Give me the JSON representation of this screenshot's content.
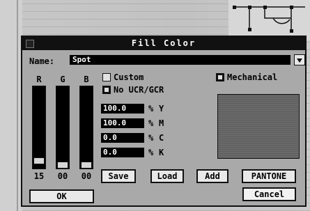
{
  "window": {
    "title": "Fill Color"
  },
  "name": {
    "label": "Name:",
    "value": "Spot"
  },
  "rgb": {
    "labels": [
      "R",
      "G",
      "B"
    ],
    "values": [
      "15",
      "00",
      "00"
    ],
    "levels": [
      0.06,
      0.0,
      0.0
    ]
  },
  "options": {
    "custom": {
      "label": "Custom",
      "checked": false
    },
    "no_ucr_gcr": {
      "label": "No UCR/GCR",
      "checked": true
    },
    "mechanical": {
      "label": "Mechanical",
      "checked": true
    }
  },
  "cmyk": {
    "percent_symbol": "%",
    "rows": [
      {
        "value": "100.0",
        "letter": "Y"
      },
      {
        "value": "100.0",
        "letter": "M"
      },
      {
        "value": "0.0",
        "letter": "C"
      },
      {
        "value": "0.0",
        "letter": "K"
      }
    ]
  },
  "buttons": {
    "save": "Save",
    "load": "Load",
    "add": "Add",
    "pantone": "PANTONE",
    "ok": "OK",
    "cancel": "Cancel"
  },
  "colors": {
    "swatch": "#6a6a6a",
    "dialog_bg": "#a9a9a9",
    "field_bg": "#000000"
  }
}
